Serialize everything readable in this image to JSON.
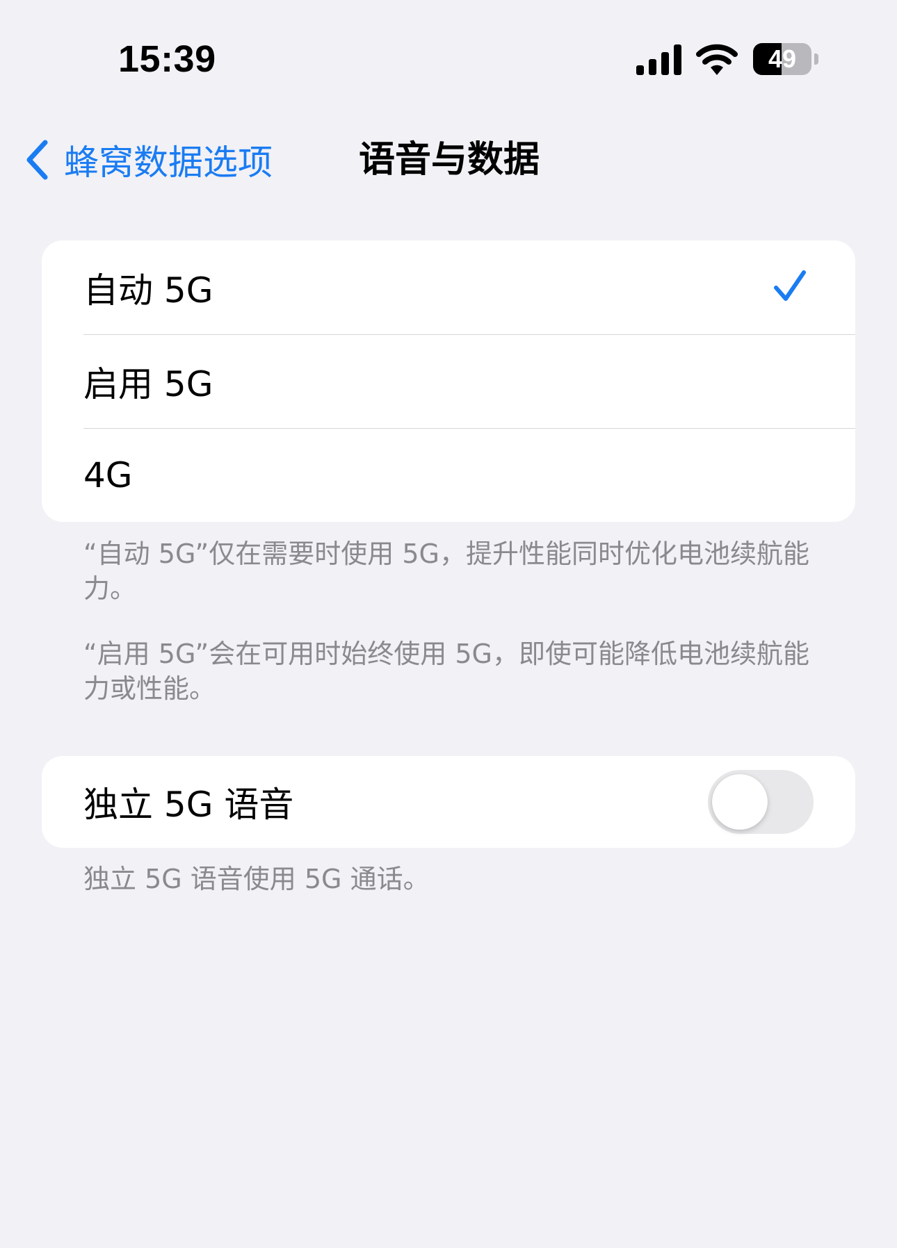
{
  "status_bar": {
    "time": "15:39",
    "battery_level": "49",
    "battery_fraction": 0.49,
    "icons": [
      "cellular-signal-icon",
      "wifi-icon",
      "battery-icon"
    ]
  },
  "nav": {
    "back_label": "蜂窝数据选项",
    "title": "语音与数据"
  },
  "options": [
    {
      "label": "自动 5G",
      "selected": true
    },
    {
      "label": "启用 5G",
      "selected": false
    },
    {
      "label": "4G",
      "selected": false
    }
  ],
  "notes": {
    "auto": "“自动 5G”仅在需要时使用 5G，提升性能同时优化电池续航能力。",
    "enable": "“启用 5G”会在可用时始终使用 5G，即使可能降低电池续航能力或性能。"
  },
  "voice": {
    "label": "独立 5G 语音",
    "enabled": false,
    "note": "独立 5G 语音使用 5G 通话。"
  },
  "colors": {
    "accent": "#1a7cf2",
    "background": "#f1f1f6",
    "footnote": "#8a8a8e"
  }
}
